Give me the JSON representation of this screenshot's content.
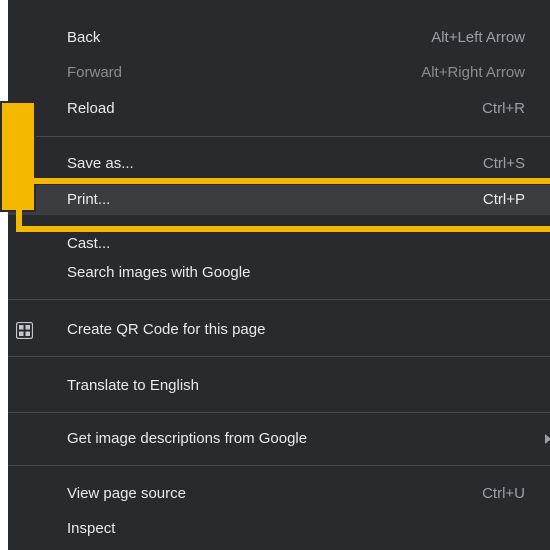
{
  "menu": {
    "items": [
      {
        "label": "Back",
        "shortcut": "Alt+Left Arrow"
      },
      {
        "label": "Forward",
        "shortcut": "Alt+Right Arrow",
        "disabled": true
      },
      {
        "label": "Reload",
        "shortcut": "Ctrl+R"
      },
      {
        "label": "Save as...",
        "shortcut": "Ctrl+S"
      },
      {
        "label": "Print...",
        "shortcut": "Ctrl+P",
        "highlighted": true
      },
      {
        "label": "Cast..."
      },
      {
        "label": "Search images with Google"
      },
      {
        "label": "Create QR Code for this page",
        "icon": "qr-code-icon"
      },
      {
        "label": "Translate to English"
      },
      {
        "label": "Get image descriptions from Google",
        "submenu": true
      },
      {
        "label": "View page source",
        "shortcut": "Ctrl+U"
      },
      {
        "label": "Inspect"
      }
    ]
  },
  "colors": {
    "menu_background": "#292a2d",
    "menu_text": "#e8eaed",
    "hover_background": "#3c3d40",
    "highlight": "#f5b800"
  }
}
